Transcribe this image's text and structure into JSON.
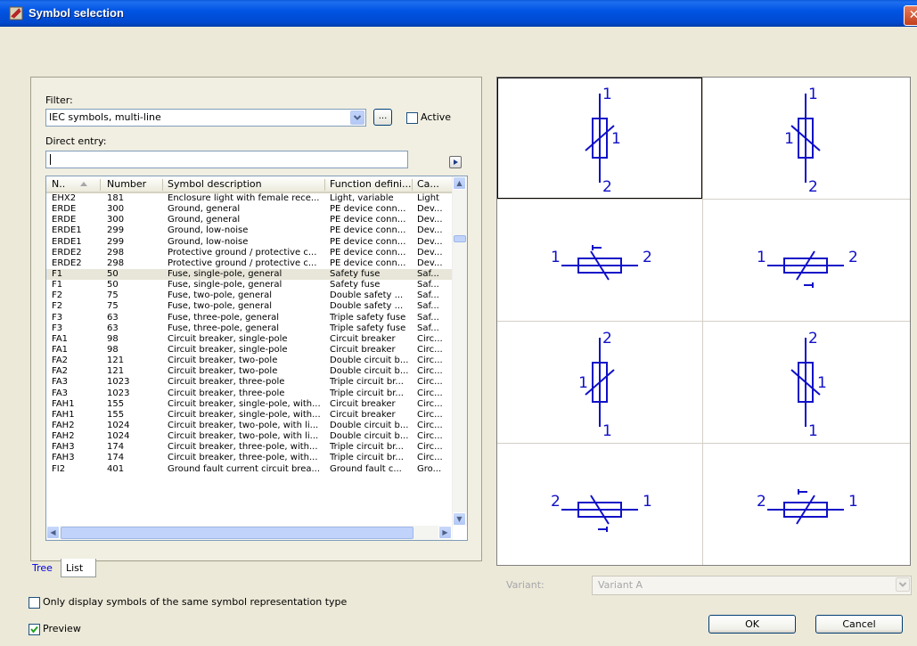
{
  "window": {
    "title": "Symbol selection",
    "close_glyph": "✕"
  },
  "filter": {
    "label": "Filter:",
    "value": "IEC symbols, multi-line",
    "browse_label": "...",
    "active_label": "Active",
    "active_checked": false
  },
  "direct_entry": {
    "label": "Direct entry:",
    "value": ""
  },
  "table": {
    "columns": [
      "N..",
      "Number",
      "Symbol description",
      "Function defini...",
      "Ca..."
    ],
    "rows": [
      [
        "EHX2",
        "181",
        "Enclosure light with female rece...",
        "Light, variable",
        "Light"
      ],
      [
        "ERDE",
        "300",
        "Ground, general",
        "PE device conn...",
        "Dev..."
      ],
      [
        "ERDE",
        "300",
        "Ground, general",
        "PE device conn...",
        "Dev..."
      ],
      [
        "ERDE1",
        "299",
        "Ground, low-noise",
        "PE device conn...",
        "Dev..."
      ],
      [
        "ERDE1",
        "299",
        "Ground, low-noise",
        "PE device conn...",
        "Dev..."
      ],
      [
        "ERDE2",
        "298",
        "Protective ground / protective c...",
        "PE device conn...",
        "Dev..."
      ],
      [
        "ERDE2",
        "298",
        "Protective ground / protective c...",
        "PE device conn...",
        "Dev..."
      ],
      [
        "F1",
        "50",
        "Fuse, single-pole, general",
        "Safety fuse",
        "Saf..."
      ],
      [
        "F1",
        "50",
        "Fuse, single-pole, general",
        "Safety fuse",
        "Saf..."
      ],
      [
        "F2",
        "75",
        "Fuse, two-pole, general",
        "Double safety ...",
        "Saf..."
      ],
      [
        "F2",
        "75",
        "Fuse, two-pole, general",
        "Double safety ...",
        "Saf..."
      ],
      [
        "F3",
        "63",
        "Fuse, three-pole, general",
        "Triple safety fuse",
        "Saf..."
      ],
      [
        "F3",
        "63",
        "Fuse, three-pole, general",
        "Triple safety fuse",
        "Saf..."
      ],
      [
        "FA1",
        "98",
        "Circuit breaker, single-pole",
        "Circuit breaker",
        "Circ..."
      ],
      [
        "FA1",
        "98",
        "Circuit breaker, single-pole",
        "Circuit breaker",
        "Circ..."
      ],
      [
        "FA2",
        "121",
        "Circuit breaker, two-pole",
        "Double circuit b...",
        "Circ..."
      ],
      [
        "FA2",
        "121",
        "Circuit breaker, two-pole",
        "Double circuit b...",
        "Circ..."
      ],
      [
        "FA3",
        "1023",
        "Circuit breaker, three-pole",
        "Triple circuit br...",
        "Circ..."
      ],
      [
        "FA3",
        "1023",
        "Circuit breaker, three-pole",
        "Triple circuit br...",
        "Circ..."
      ],
      [
        "FAH1",
        "155",
        "Circuit breaker, single-pole, with...",
        "Circuit breaker",
        "Circ..."
      ],
      [
        "FAH1",
        "155",
        "Circuit breaker, single-pole, with...",
        "Circuit breaker",
        "Circ..."
      ],
      [
        "FAH2",
        "1024",
        "Circuit breaker, two-pole, with li...",
        "Double circuit b...",
        "Circ..."
      ],
      [
        "FAH2",
        "1024",
        "Circuit breaker, two-pole, with li...",
        "Double circuit b...",
        "Circ..."
      ],
      [
        "FAH3",
        "174",
        "Circuit breaker, three-pole, with...",
        "Triple circuit br...",
        "Circ..."
      ],
      [
        "FAH3",
        "174",
        "Circuit breaker, three-pole, with...",
        "Triple circuit br...",
        "Circ..."
      ],
      [
        "FI2",
        "401",
        "Ground fault current circuit brea...",
        "Ground fault c...",
        "Gro..."
      ]
    ],
    "selected_row": 7
  },
  "tabs": [
    {
      "label": "Tree"
    },
    {
      "label": "List"
    }
  ],
  "options": {
    "same_type_label": "Only display symbols of the same symbol representation type",
    "same_type_checked": false,
    "preview_label": "Preview",
    "preview_checked": true
  },
  "symbols": [
    {
      "orient": "v",
      "top": "1",
      "bottom": "2",
      "side": "1",
      "side_pos": "right",
      "slash": "up"
    },
    {
      "orient": "v",
      "top": "1",
      "bottom": "2",
      "side": "1",
      "side_pos": "left",
      "slash": "down"
    },
    {
      "orient": "h",
      "left": "1",
      "right": "2",
      "tick": "top",
      "slash": "down"
    },
    {
      "orient": "h",
      "left": "1",
      "right": "2",
      "tick": "bottom",
      "slash": "up"
    },
    {
      "orient": "v",
      "top": "2",
      "bottom": "1",
      "side": "1",
      "side_pos": "left",
      "slash": "up"
    },
    {
      "orient": "v",
      "top": "2",
      "bottom": "1",
      "side": "1",
      "side_pos": "right",
      "slash": "down"
    },
    {
      "orient": "h",
      "left": "2",
      "right": "1",
      "tick": "bottom",
      "slash": "down"
    },
    {
      "orient": "h",
      "left": "2",
      "right": "1",
      "tick": "top",
      "slash": "up"
    }
  ],
  "symbol_color": "#1010c8",
  "variant": {
    "label": "Variant:",
    "value": "Variant A"
  },
  "buttons": {
    "ok": "OK",
    "cancel": "Cancel"
  }
}
